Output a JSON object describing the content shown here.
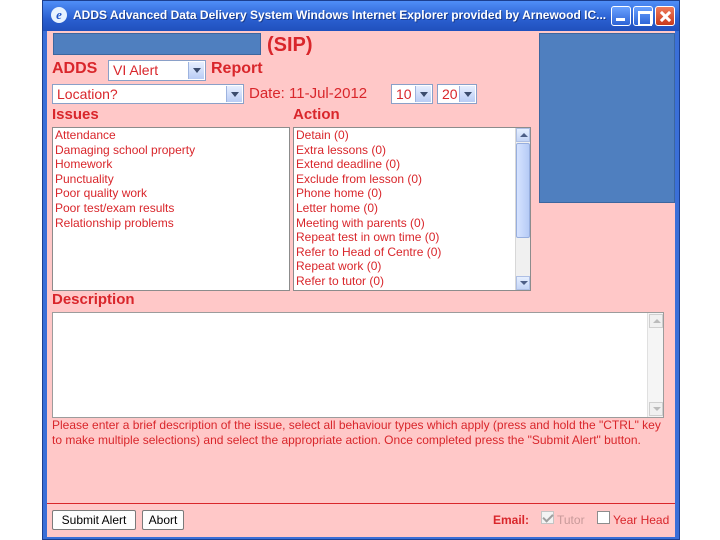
{
  "window": {
    "title": "ADDS   Advanced Data Delivery System   Windows Internet Explorer provided by Arnewood IC..."
  },
  "header": {
    "sip_label": "(SIP)",
    "adds_label": "ADDS",
    "report_label": "Report",
    "alert_type": "VI Alert",
    "location_placeholder": "Location?",
    "date_label": "Date: 11-Jul-2012",
    "hour": "10",
    "minute": "20"
  },
  "issues": {
    "label": "Issues",
    "items": [
      "Attendance",
      "Damaging school property",
      "Homework",
      "Punctuality",
      "Poor quality work",
      "Poor test/exam results",
      "Relationship problems"
    ]
  },
  "actions": {
    "label": "Action",
    "items": [
      "Detain (0)",
      "Extra lessons (0)",
      "Extend deadline (0)",
      "Exclude from lesson (0)",
      "Phone home (0)",
      "Letter home (0)",
      "Meeting with parents (0)",
      "Repeat test in own time (0)",
      "Refer to Head of Centre (0)",
      "Repeat work (0)",
      "Refer to tutor (0)"
    ]
  },
  "description": {
    "label": "Description",
    "value": ""
  },
  "help_text": "Please enter a brief description of the issue, select all behaviour types which apply (press and hold the \"CTRL\" key to make multiple selections) and select the appropriate action. Once completed press the \"Submit Alert\" button.",
  "footer": {
    "submit_label": "Submit Alert",
    "abort_label": "Abort",
    "email_label": "Email:",
    "tutor_label": "Tutor",
    "year_head_label": "Year Head",
    "tutor_checked": true,
    "year_head_checked": false
  },
  "colors": {
    "accent": "#d9262b",
    "panel": "#ffc8c8",
    "block": "#4f7fbf",
    "titlebar": "#2a5fd0"
  }
}
